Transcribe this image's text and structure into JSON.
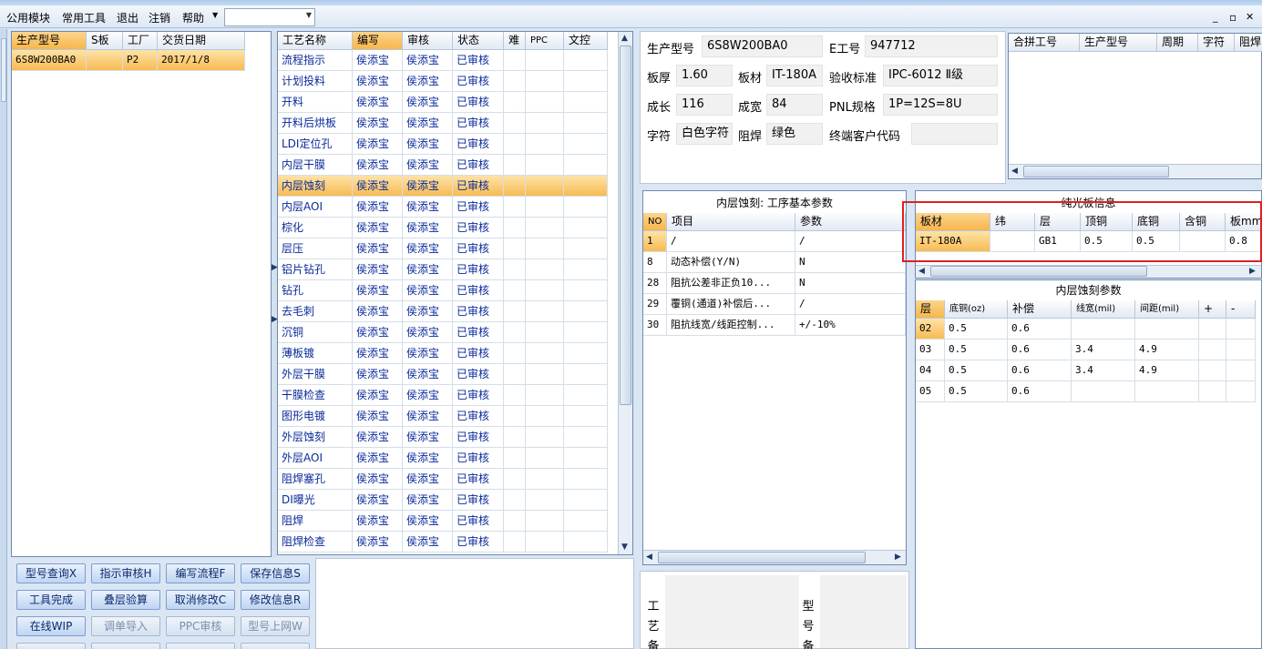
{
  "menu": {
    "items": [
      "公用模块",
      "常用工具",
      "退出",
      "注销",
      "帮助"
    ],
    "combo_value": ""
  },
  "window_controls": {
    "minimize": "_",
    "restore": "▫",
    "close": "✕"
  },
  "models_grid": {
    "headers": [
      "生产型号",
      "S板",
      "工厂",
      "交货日期"
    ],
    "rows": [
      [
        "6S8W200BA0",
        "",
        "P2",
        "2017/1/8"
      ]
    ]
  },
  "process_grid": {
    "headers": [
      "工艺名称",
      "编写",
      "审核",
      "状态",
      "难",
      "PPC",
      "文控"
    ],
    "rows": [
      [
        "流程指示",
        "侯添宝",
        "侯添宝",
        "已审核"
      ],
      [
        "计划投料",
        "侯添宝",
        "侯添宝",
        "已审核"
      ],
      [
        "开料",
        "侯添宝",
        "侯添宝",
        "已审核"
      ],
      [
        "开料后烘板",
        "侯添宝",
        "侯添宝",
        "已审核"
      ],
      [
        "LDI定位孔",
        "侯添宝",
        "侯添宝",
        "已审核"
      ],
      [
        "内层干膜",
        "侯添宝",
        "侯添宝",
        "已审核"
      ],
      [
        "内层蚀刻",
        "侯添宝",
        "侯添宝",
        "已审核"
      ],
      [
        "内层AOI",
        "侯添宝",
        "侯添宝",
        "已审核"
      ],
      [
        "棕化",
        "侯添宝",
        "侯添宝",
        "已审核"
      ],
      [
        "层压",
        "侯添宝",
        "侯添宝",
        "已审核"
      ],
      [
        "铝片钻孔",
        "侯添宝",
        "侯添宝",
        "已审核"
      ],
      [
        "钻孔",
        "侯添宝",
        "侯添宝",
        "已审核"
      ],
      [
        "去毛刺",
        "侯添宝",
        "侯添宝",
        "已审核"
      ],
      [
        "沉铜",
        "侯添宝",
        "侯添宝",
        "已审核"
      ],
      [
        "薄板镀",
        "侯添宝",
        "侯添宝",
        "已审核"
      ],
      [
        "外层干膜",
        "侯添宝",
        "侯添宝",
        "已审核"
      ],
      [
        "干膜检查",
        "侯添宝",
        "侯添宝",
        "已审核"
      ],
      [
        "图形电镀",
        "侯添宝",
        "侯添宝",
        "已审核"
      ],
      [
        "外层蚀刻",
        "侯添宝",
        "侯添宝",
        "已审核"
      ],
      [
        "外层AOI",
        "侯添宝",
        "侯添宝",
        "已审核"
      ],
      [
        "阻焊塞孔",
        "侯添宝",
        "侯添宝",
        "已审核"
      ],
      [
        "DI曝光",
        "侯添宝",
        "侯添宝",
        "已审核"
      ],
      [
        "阻焊",
        "侯添宝",
        "侯添宝",
        "已审核"
      ],
      [
        "阻焊检查",
        "侯添宝",
        "侯添宝",
        "已审核"
      ]
    ],
    "selected_index": 6
  },
  "buttons": [
    [
      "型号查询X",
      "指示审核H",
      "编写流程F",
      "保存信息S"
    ],
    [
      "工具完成",
      "叠层验算",
      "取消修改C",
      "修改信息R"
    ],
    [
      "在线WIP",
      "调单导入",
      "PPC审核",
      "型号上网W"
    ]
  ],
  "buttons_disabled": [
    [
      "在线WIP",
      false
    ],
    [
      "调单导入",
      true
    ],
    [
      "PPC审核",
      true
    ],
    [
      "型号上网W",
      true
    ]
  ],
  "info": {
    "model_label": "生产型号",
    "model": "6S8W200BA0",
    "eno_label": "E工号",
    "eno": "947712",
    "thick_label": "板厚",
    "thick": "1.60",
    "mat_label": "板材",
    "mat": "IT-180A",
    "std_label": "验收标准",
    "std": "IPC-6012 Ⅱ级",
    "len_label": "成长",
    "len": "116",
    "wid_label": "成宽",
    "wid": "84",
    "pnl_label": "PNL规格",
    "pnl": "1P=12S=8U",
    "char_label": "字符",
    "char": "白色字符",
    "sm_label": "阻焊",
    "sm": "绿色",
    "cust_label": "终端客户代码",
    "cust": ""
  },
  "merge_grid": {
    "headers": [
      "合拼工号",
      "生产型号",
      "周期",
      "字符",
      "阻焊"
    ]
  },
  "proc_params": {
    "title": "内层蚀刻: 工序基本参数",
    "headers": [
      "NO",
      "项目",
      "参数"
    ],
    "rows": [
      [
        "1",
        "/",
        "/"
      ],
      [
        "8",
        "动态补偿(Y/N)",
        "N"
      ],
      [
        "28",
        "阻抗公差非正负10...",
        "N"
      ],
      [
        "29",
        "覆铜(通道)补偿后...",
        "/"
      ],
      [
        "30",
        "阻抗线宽/线距控制...",
        "+/-10%"
      ]
    ]
  },
  "board_info": {
    "title": "纯光板信息",
    "headers": [
      "板材",
      "纬",
      "层",
      "顶铜",
      "底铜",
      "含铜",
      "板mm"
    ],
    "rows": [
      [
        "IT-180A",
        "",
        "GB1",
        "0.5",
        "0.5",
        "",
        "0.8"
      ]
    ]
  },
  "etch_params": {
    "title": "内层蚀刻参数",
    "headers": [
      "层",
      "底铜(oz)",
      "补偿",
      "线宽(mil)",
      "间距(mil)",
      "+",
      "-"
    ],
    "rows": [
      [
        "02",
        "0.5",
        "0.6",
        "",
        "",
        "",
        ""
      ],
      [
        "03",
        "0.5",
        "0.6",
        "3.4",
        "4.9",
        "",
        ""
      ],
      [
        "04",
        "0.5",
        "0.6",
        "3.4",
        "4.9",
        "",
        ""
      ],
      [
        "05",
        "0.5",
        "0.6",
        "",
        "",
        "",
        ""
      ]
    ]
  },
  "notes": {
    "process_label": "工艺备",
    "model_label": "型号备"
  }
}
